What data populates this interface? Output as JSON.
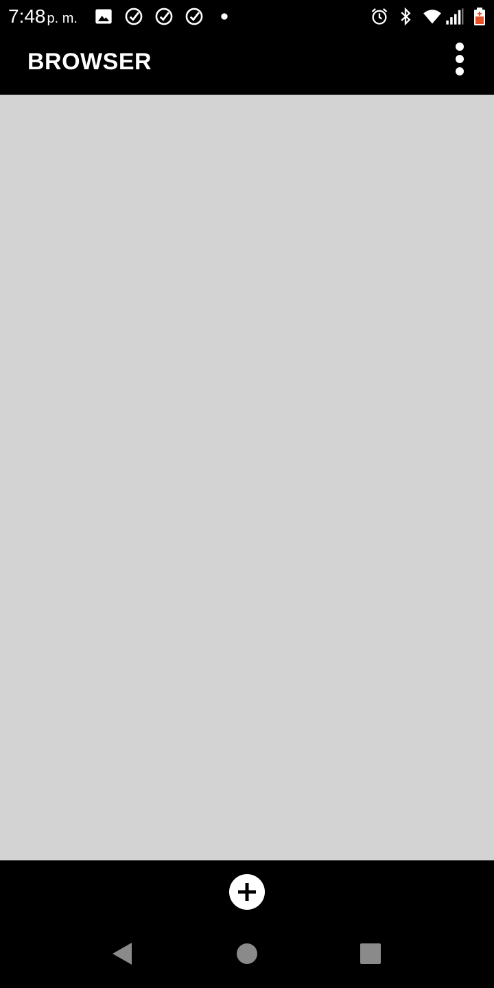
{
  "status_bar": {
    "time": "7:48",
    "ampm": "p. m.",
    "notification_icons": [
      "image-icon",
      "check-circle-icon",
      "check-circle-icon",
      "check-circle-icon",
      "dot-icon"
    ],
    "system_icons": [
      "alarm-icon",
      "bluetooth-icon",
      "wifi-icon",
      "signal-icon",
      "battery-icon"
    ],
    "battery_color": "#e8502a"
  },
  "app_bar": {
    "title": "BROWSER",
    "menu_icon": "more-vert-icon"
  },
  "content": {
    "background": "#d3d3d3"
  },
  "bottom_bar": {
    "add_icon": "plus-circle-icon"
  },
  "nav_bar": {
    "buttons": [
      "back-icon",
      "home-icon",
      "recents-icon"
    ],
    "color": "#8a8a8a"
  }
}
